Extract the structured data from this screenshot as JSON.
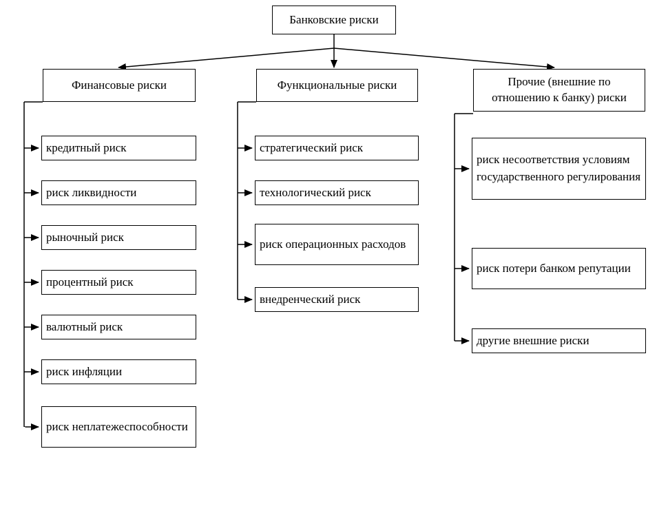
{
  "root": {
    "title": "Банковские риски"
  },
  "columns": [
    {
      "header": "Финансовые риски",
      "items": [
        "кредитный риск",
        "риск ликвидности",
        "рыночный риск",
        "процентный риск",
        "валютный риск",
        "риск инфляции",
        "риск неплатежеспособности"
      ]
    },
    {
      "header": "Функциональные риски",
      "items": [
        "стратегический риск",
        "технологический риск",
        "риск операционных расходов",
        "внедренческий риск"
      ]
    },
    {
      "header": "Прочие (внешние по отношению к банку) риски",
      "items": [
        "риск несоответствия условиям государственного регулирования",
        "риск потери банком репутации",
        "другие внешние риски"
      ]
    }
  ]
}
